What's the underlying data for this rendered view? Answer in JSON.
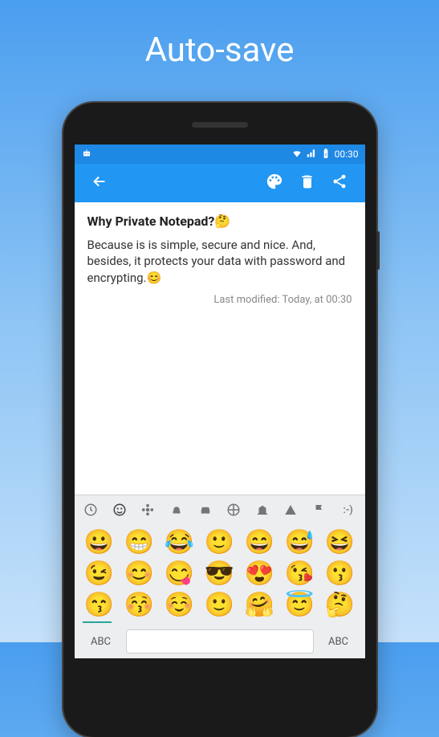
{
  "hero": {
    "title": "Auto-save"
  },
  "status": {
    "time": "00:30"
  },
  "appbar": {
    "actions": [
      "palette",
      "delete",
      "share"
    ]
  },
  "note": {
    "title": "Why Private Notepad?🤔",
    "body": "Because is is simple, secure and nice. And, besides, it protects your data with password and encrypting.😊",
    "modified": "Last modified: Today, at 00:30"
  },
  "keyboard": {
    "tabs": [
      "recent",
      "face",
      "flower",
      "food",
      "car",
      "sport",
      "crown",
      "symbol",
      "flag",
      "text"
    ],
    "rows": [
      [
        "😀",
        "😁",
        "😂",
        "🙂",
        "😄",
        "😅",
        "😆"
      ],
      [
        "😉",
        "😊",
        "😋",
        "😎",
        "😍",
        "😘",
        "😗"
      ],
      [
        "😙",
        "😚",
        "☺️",
        "🙂",
        "🤗",
        "😇",
        "🤔"
      ]
    ],
    "abc": "ABC"
  }
}
